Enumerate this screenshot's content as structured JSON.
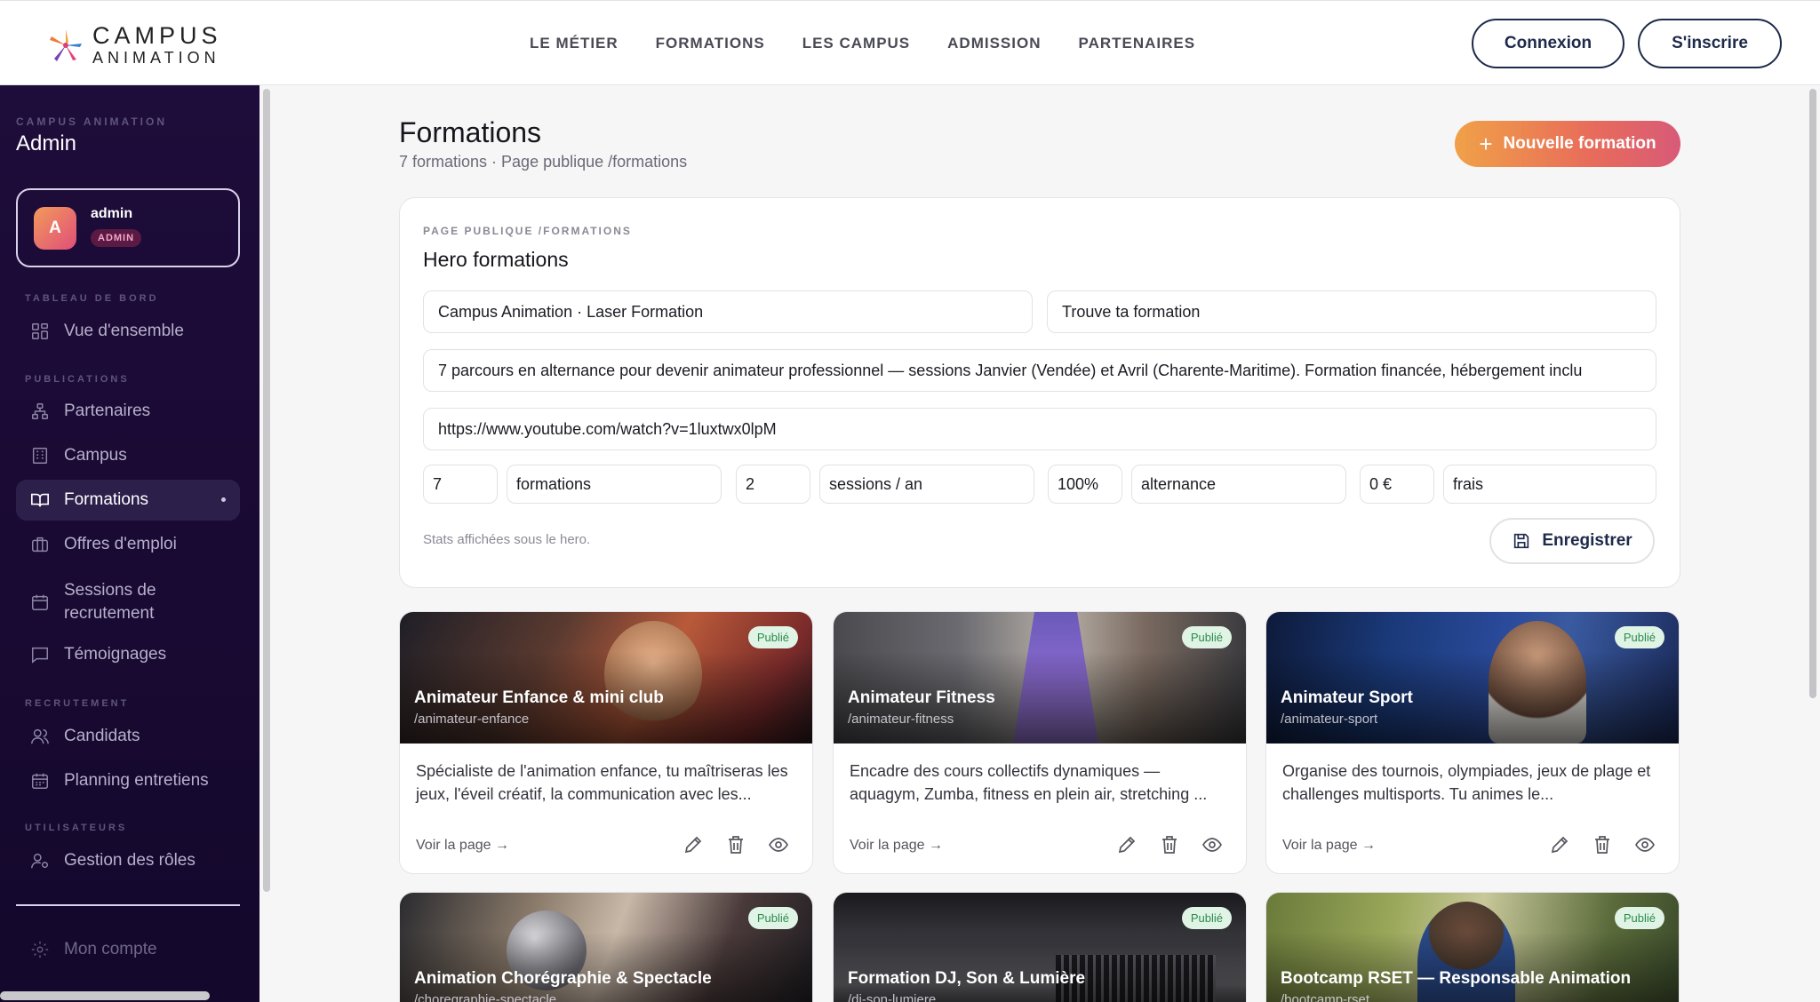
{
  "brand": {
    "line1": "CAMPUS",
    "line2": "ANIMATION"
  },
  "nav": [
    "LE MÉTIER",
    "FORMATIONS",
    "LES CAMPUS",
    "ADMISSION",
    "PARTENAIRES"
  ],
  "auth": {
    "login": "Connexion",
    "signup": "S'inscrire"
  },
  "sidebar": {
    "caption": "CAMPUS ANIMATION",
    "title": "Admin",
    "user": {
      "initial": "A",
      "name": "admin",
      "role": "ADMIN"
    },
    "sections": {
      "dashboard": "TABLEAU DE BORD",
      "publications": "PUBLICATIONS",
      "recruitment": "RECRUTEMENT",
      "users": "UTILISATEURS"
    },
    "items": {
      "overview": "Vue d'ensemble",
      "partners": "Partenaires",
      "campus": "Campus",
      "formations": "Formations",
      "jobs": "Offres d'emploi",
      "sessions_line1": "Sessions de",
      "sessions_line2": "recrutement",
      "testimonials": "Témoignages",
      "candidates": "Candidats",
      "planning": "Planning entretiens",
      "roles": "Gestion des rôles",
      "account": "Mon compte"
    }
  },
  "page": {
    "title": "Formations",
    "subtitle": "7 formations · Page publique /formations",
    "new_button": "Nouvelle formation"
  },
  "hero": {
    "caption": "PAGE PUBLIQUE /FORMATIONS",
    "title": "Hero formations",
    "eyebrow": "Campus Animation · Laser Formation",
    "headline": "Trouve ta formation",
    "description": "7 parcours en alternance pour devenir animateur professionnel — sessions Janvier (Vendée) et Avril (Charente-Maritime). Formation financée, hébergement inclu",
    "video_url": "https://www.youtube.com/watch?v=1luxtwx0lpM",
    "stats": [
      {
        "value": "7",
        "label": "formations"
      },
      {
        "value": "2",
        "label": "sessions / an"
      },
      {
        "value": "100%",
        "label": "alternance"
      },
      {
        "value": "0 €",
        "label": "frais"
      }
    ],
    "stats_note": "Stats affichées sous le hero.",
    "save_button": "Enregistrer"
  },
  "formations": [
    {
      "title": "Animateur Enfance & mini club",
      "slug": "/animateur-enfance",
      "status": "Publié",
      "description": "Spécialiste de l'animation enfance, tu maîtriseras les jeux, l'éveil créatif, la communication avec les...",
      "link": "Voir la page →"
    },
    {
      "title": "Animateur Fitness",
      "slug": "/animateur-fitness",
      "status": "Publié",
      "description": "Encadre des cours collectifs dynamiques — aquagym, Zumba, fitness en plein air, stretching ...",
      "link": "Voir la page →"
    },
    {
      "title": "Animateur Sport",
      "slug": "/animateur-sport",
      "status": "Publié",
      "description": "Organise des tournois, olympiades, jeux de plage et challenges multisports. Tu animes le...",
      "link": "Voir la page →"
    },
    {
      "title": "Animation Chorégraphie & Spectacle",
      "slug": "/choregraphie-spectacle",
      "status": "Publié"
    },
    {
      "title": "Formation DJ, Son & Lumière",
      "slug": "/dj-son-lumiere",
      "status": "Publié"
    },
    {
      "title": "Bootcamp RSET — Responsable Animation",
      "slug": "/bootcamp-rset",
      "status": "Publié"
    }
  ]
}
